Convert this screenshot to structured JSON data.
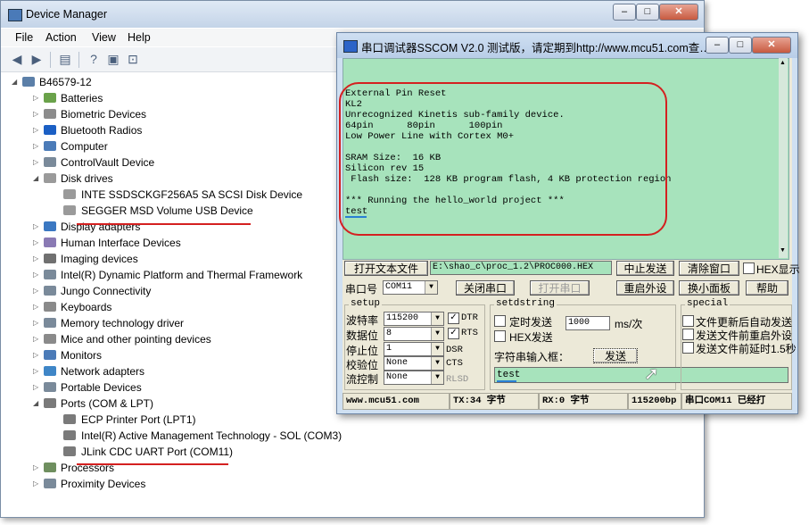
{
  "device_manager": {
    "title": "Device Manager",
    "menu": [
      "File",
      "Action",
      "View",
      "Help"
    ],
    "toolbar_icons": [
      "back-icon",
      "forward-icon",
      "properties-icon",
      "help-icon",
      "scan-icon",
      "display-icon"
    ],
    "tree": [
      {
        "label": "B46579-12",
        "level": 0,
        "expanded": true,
        "icon": "computer-icon"
      },
      {
        "label": "Batteries",
        "level": 1,
        "icon": "battery-icon"
      },
      {
        "label": "Biometric Devices",
        "level": 1,
        "icon": "fingerprint-icon"
      },
      {
        "label": "Bluetooth Radios",
        "level": 1,
        "icon": "bluetooth-icon"
      },
      {
        "label": "Computer",
        "level": 1,
        "icon": "monitor-icon"
      },
      {
        "label": "ControlVault Device",
        "level": 1,
        "icon": "device-icon"
      },
      {
        "label": "Disk drives",
        "level": 1,
        "expanded": true,
        "icon": "disk-icon"
      },
      {
        "label": "INTE    SSDSCKGF256A5 SA SCSI Disk Device",
        "level": 2,
        "icon": "disk-icon"
      },
      {
        "label": "SEGGER MSD Volume USB Device",
        "level": 2,
        "icon": "disk-icon",
        "underlined": true
      },
      {
        "label": "Display adapters",
        "level": 1,
        "icon": "display-icon"
      },
      {
        "label": "Human Interface Devices",
        "level": 1,
        "icon": "hid-icon"
      },
      {
        "label": "Imaging devices",
        "level": 1,
        "icon": "camera-icon"
      },
      {
        "label": "Intel(R) Dynamic Platform and Thermal Framework",
        "level": 1,
        "icon": "device-icon"
      },
      {
        "label": "Jungo Connectivity",
        "level": 1,
        "icon": "device-icon"
      },
      {
        "label": "Keyboards",
        "level": 1,
        "icon": "keyboard-icon"
      },
      {
        "label": "Memory technology driver",
        "level": 1,
        "icon": "device-icon"
      },
      {
        "label": "Mice and other pointing devices",
        "level": 1,
        "icon": "mouse-icon"
      },
      {
        "label": "Monitors",
        "level": 1,
        "icon": "monitor-icon"
      },
      {
        "label": "Network adapters",
        "level": 1,
        "icon": "network-icon"
      },
      {
        "label": "Portable Devices",
        "level": 1,
        "icon": "device-icon"
      },
      {
        "label": "Ports (COM & LPT)",
        "level": 1,
        "expanded": true,
        "icon": "port-icon"
      },
      {
        "label": "ECP Printer Port (LPT1)",
        "level": 2,
        "icon": "port-icon"
      },
      {
        "label": "Intel(R) Active Management Technology - SOL (COM3)",
        "level": 2,
        "icon": "port-icon"
      },
      {
        "label": "JLink CDC UART Port (COM11)",
        "level": 2,
        "icon": "port-icon",
        "underlined": true
      },
      {
        "label": "Processors",
        "level": 1,
        "icon": "cpu-icon"
      },
      {
        "label": "Proximity Devices",
        "level": 1,
        "icon": "device-icon"
      }
    ]
  },
  "sscom": {
    "title": "串口调试器SSCOM V2.0  测试版，请定期到http://www.mcu51.com查…",
    "console_lines": [
      "External Pin Reset",
      "KL2",
      "Unrecognized Kinetis sub-family device.",
      "64pin      80pin      100pin",
      "Low Power Line with Cortex M0+",
      "",
      "SRAM Size:  16 KB",
      "Silicon rev 15",
      " Flash size:  128 KB program flash, 4 KB protection region",
      "",
      "*** Running the hello_world project ***",
      "test"
    ],
    "open_file_btn": "打开文本文件",
    "file_path": "E:\\shao_c\\proc_1.2\\PROC000.HEX",
    "stop_send_btn": "中止发送",
    "clear_window_btn": "清除窗口",
    "hex_display_label": "HEX显示",
    "port_label": "串口号",
    "port_value": "COM11",
    "close_port_btn": "关闭串口",
    "open_port_btn": "打开串口",
    "reset_ext_btn": "重启外设",
    "small_panel_btn": "换小面板",
    "help_btn": "帮助",
    "setup_title": "setup",
    "baud_label": "波特率",
    "baud_value": "115200",
    "databits_label": "数据位",
    "databits_value": "8",
    "stopbits_label": "停止位",
    "stopbits_value": "1",
    "parity_label": "校验位",
    "parity_value": "None",
    "flow_label": "流控制",
    "flow_value": "None",
    "dtr_label": "DTR",
    "rts_label": "RTS",
    "dsr_label": "DSR",
    "cts_label": "CTS",
    "rlsd_label": "RLSD",
    "setdstring_title": "setdstring",
    "timed_send_label": "定时发送",
    "interval_value": "1000",
    "interval_unit": "ms/次",
    "hex_send_label": "HEX发送",
    "input_label": "字符串输入框：",
    "send_btn": "发送",
    "input_value": "test",
    "special_title": "special",
    "special_1": "文件更新后自动发送",
    "special_2": "发送文件前重启外设",
    "special_3": "发送文件前延时1.5秒",
    "status": {
      "site": "www.mcu51.com",
      "tx": "TX:34 字节",
      "rx": "RX:0 字节",
      "baud": "115200bp",
      "port": "串口COM11 已经打"
    }
  },
  "colors": {
    "console_bg": "#a7e3bc",
    "highlight": "#d42020",
    "underline_blue": "#2a7fd4"
  }
}
